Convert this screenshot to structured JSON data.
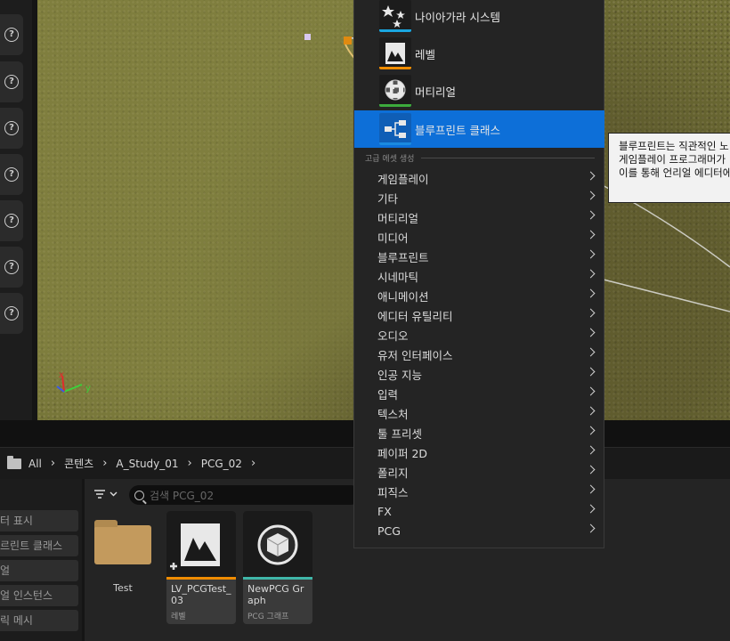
{
  "breadcrumb": {
    "items": [
      "All",
      "콘텐츠",
      "A_Study_01",
      "PCG_02"
    ]
  },
  "content_browser": {
    "search_placeholder": "검색 PCG_02",
    "filters": [
      "터 표시",
      "르린트 클래스",
      "얼",
      "얼 인스턴스",
      "릭 메시"
    ],
    "folder": {
      "label": "Test"
    },
    "assets": [
      {
        "name": "LV_PCGTest_03",
        "type": "레벨",
        "stripe_color": "#f08c00",
        "icon": "level-icon"
      },
      {
        "name": "NewPCG Graph",
        "type": "PCG 그래프",
        "stripe_color": "#3fb6a8",
        "icon": "pcg-graph-icon"
      }
    ]
  },
  "context_menu": {
    "featured": [
      {
        "label": "나이아가라 시스템",
        "icon": "niagara-system-icon",
        "stripe_color": "#1aa6e0"
      },
      {
        "label": "레벨",
        "icon": "level-icon",
        "stripe_color": "#f08c00"
      },
      {
        "label": "머티리얼",
        "icon": "material-icon",
        "stripe_color": "#3caa3c"
      },
      {
        "label": "블루프린트 클래스",
        "icon": "blueprint-class-icon",
        "stripe_color": "#1a8ae0",
        "selected": true
      }
    ],
    "section_title": "고급 에셋 생성",
    "items": [
      "게임플레이",
      "기타",
      "머티리얼",
      "미디어",
      "블루프린트",
      "시네마틱",
      "애니메이션",
      "에디터 유틸리티",
      "오디오",
      "유저 인터페이스",
      "인공 지능",
      "입력",
      "텍스처",
      "툴 프리셋",
      "페이퍼 2D",
      "폴리지",
      "피직스",
      "FX",
      "PCG"
    ]
  },
  "tooltip": {
    "lines": [
      "블루프린트는 직관적인 노",
      "게임플레이 프로그래머가",
      "이를 통해 언리얼 에디터에"
    ]
  },
  "viewport": {
    "axis_labels": {
      "x": "x",
      "y": "y"
    }
  }
}
